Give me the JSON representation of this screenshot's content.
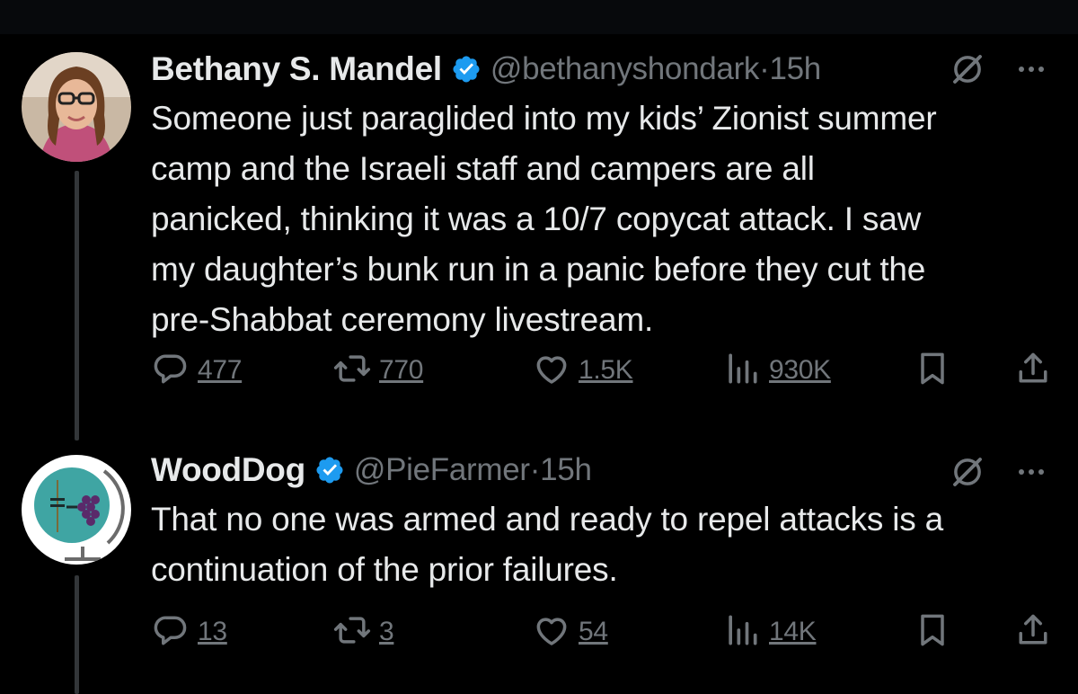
{
  "colors": {
    "background": "#000000",
    "text": "#e7e9ea",
    "secondary": "#71767b",
    "verified": "#1d9bf0",
    "thread_line": "#333639"
  },
  "tweets": [
    {
      "name": "Bethany S. Mandel",
      "handle": "@bethanyshondark",
      "time": "·15h",
      "text_lines": [
        "Someone just paraglided into my kids’ Zionist summer",
        "camp and the Israeli staff and campers are all",
        "panicked, thinking it was a 10/7 copycat attack. I saw",
        "my daughter’s bunk run in a panic before they cut the",
        "pre-Shabbat ceremony livestream."
      ],
      "replies": "477",
      "reposts": "770",
      "likes": "1.5K",
      "views": "930K"
    },
    {
      "name": "WoodDog",
      "handle": "@PieFarmer",
      "time": "·15h",
      "text_lines": [
        "That no one was armed and ready to repel attacks is a",
        "continuation of the prior failures."
      ],
      "replies": "13",
      "reposts": "3",
      "likes": "54",
      "views": "14K"
    }
  ],
  "icons": [
    "reply-icon",
    "repost-icon",
    "like-icon",
    "views-icon",
    "bookmark-icon",
    "share-icon",
    "grok-icon",
    "more-icon",
    "verified-icon"
  ]
}
